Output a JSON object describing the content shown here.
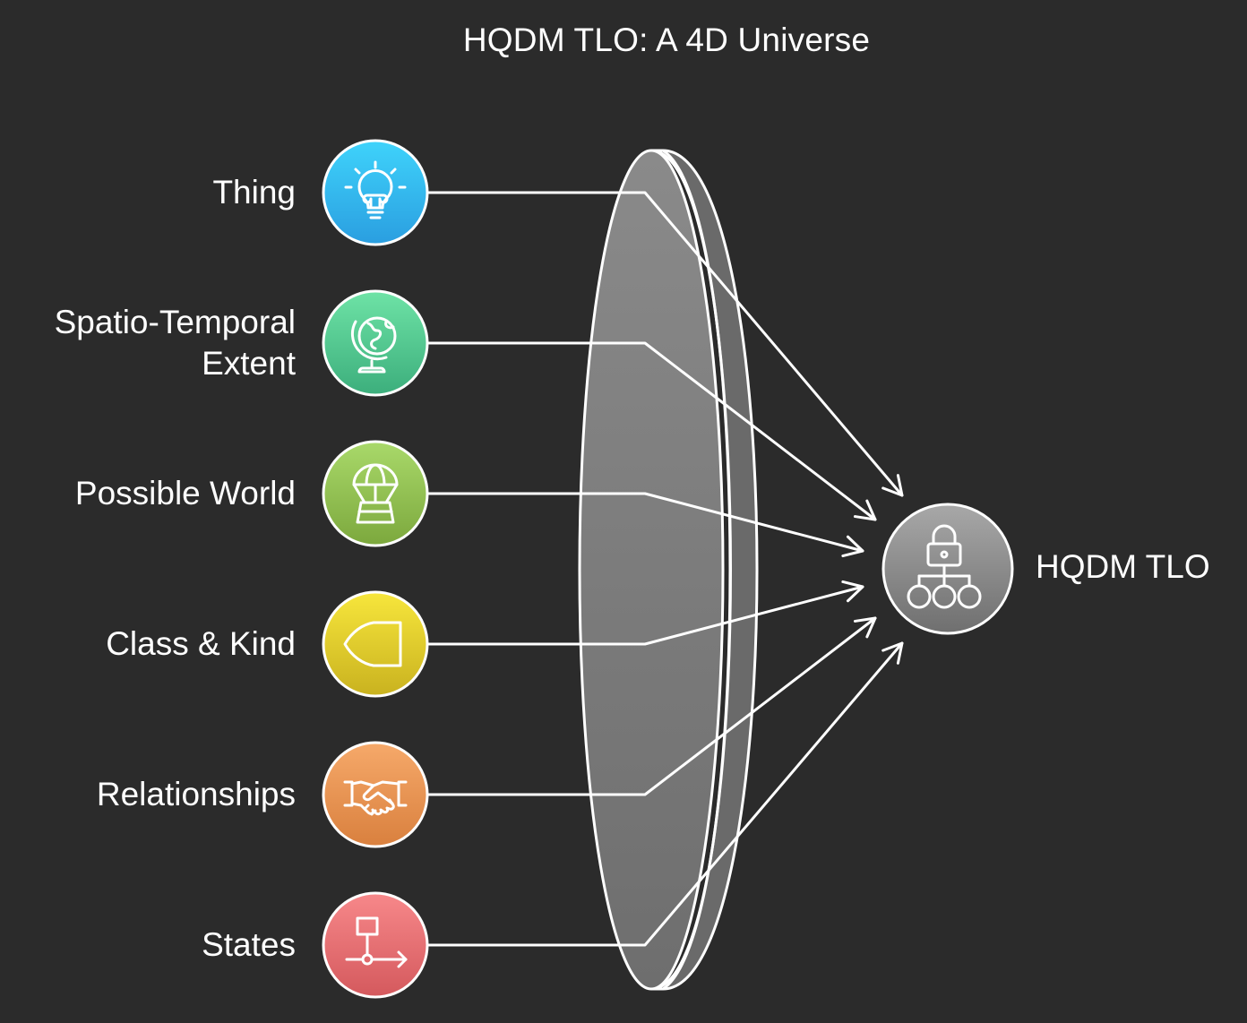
{
  "title": "HQDM TLO: A 4D Universe",
  "inputs": [
    {
      "label": "Thing",
      "icon": "lightbulb-icon",
      "color_top": "#3fd3fb",
      "color_bottom": "#2a9ee0"
    },
    {
      "label": "Spatio-Temporal\nExtent",
      "icon": "globe-icon",
      "color_top": "#6ee3a6",
      "color_bottom": "#3cae7c"
    },
    {
      "label": "Possible World",
      "icon": "parachute-icon",
      "color_top": "#a9d96a",
      "color_bottom": "#7ca83d"
    },
    {
      "label": "Class & Kind",
      "icon": "shape-tag-icon",
      "color_top": "#f7e63c",
      "color_bottom": "#c9b21f"
    },
    {
      "label": "Relationships",
      "icon": "handshake-icon",
      "color_top": "#f6a96a",
      "color_bottom": "#d9803e"
    },
    {
      "label": "States",
      "icon": "state-flow-icon",
      "color_top": "#f7888a",
      "color_bottom": "#d4595d"
    }
  ],
  "hub": {
    "label": "HQDM TLO",
    "icon": "lock-hierarchy-icon",
    "color_top": "#a8a8a8",
    "color_bottom": "#6f6f6f"
  },
  "lens_color": "#7d7d7d"
}
